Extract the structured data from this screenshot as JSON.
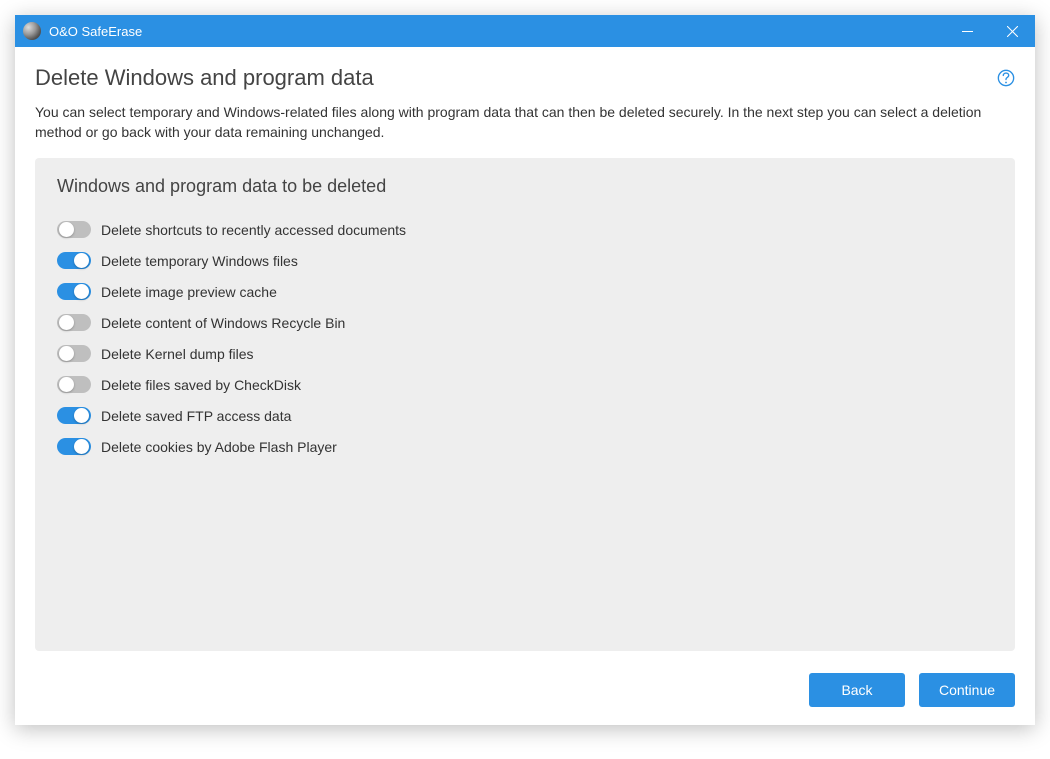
{
  "titlebar": {
    "app_name": "O&O SafeErase"
  },
  "page": {
    "title": "Delete Windows and program data",
    "description": "You can select temporary and Windows-related files along with program data that can then be deleted securely. In the next step you can select a deletion method or go back with your data remaining unchanged."
  },
  "panel": {
    "title": "Windows and program data to be deleted",
    "items": [
      {
        "label": "Delete shortcuts to recently accessed documents",
        "enabled": false
      },
      {
        "label": "Delete temporary Windows files",
        "enabled": true
      },
      {
        "label": "Delete image preview cache",
        "enabled": true
      },
      {
        "label": "Delete content of Windows Recycle Bin",
        "enabled": false
      },
      {
        "label": "Delete Kernel dump files",
        "enabled": false
      },
      {
        "label": "Delete files saved by CheckDisk",
        "enabled": false
      },
      {
        "label": "Delete saved FTP access data",
        "enabled": true
      },
      {
        "label": "Delete cookies by Adobe Flash Player",
        "enabled": true
      }
    ]
  },
  "buttons": {
    "back": "Back",
    "continue": "Continue"
  }
}
